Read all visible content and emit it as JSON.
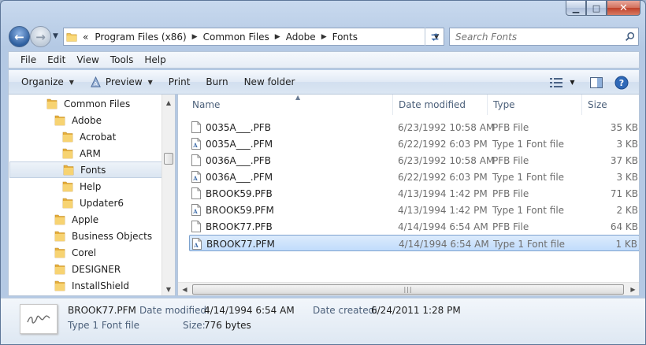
{
  "window": {
    "caption": {
      "minimize": "▁",
      "maximize": "□",
      "close": "✕"
    }
  },
  "address": {
    "overflow": "«",
    "crumbs": [
      "Program Files (x86)",
      "Common Files",
      "Adobe",
      "Fonts"
    ]
  },
  "search": {
    "placeholder": "Search Fonts"
  },
  "menu": [
    "File",
    "Edit",
    "View",
    "Tools",
    "Help"
  ],
  "toolbar": {
    "organize": "Organize",
    "preview": "Preview",
    "print": "Print",
    "burn": "Burn",
    "new_folder": "New folder"
  },
  "tree": [
    {
      "label": "Common Files",
      "level": 0
    },
    {
      "label": "Adobe",
      "level": 1
    },
    {
      "label": "Acrobat",
      "level": 2
    },
    {
      "label": "ARM",
      "level": 2
    },
    {
      "label": "Fonts",
      "level": 2,
      "selected": true
    },
    {
      "label": "Help",
      "level": 2
    },
    {
      "label": "Updater6",
      "level": 2
    },
    {
      "label": "Apple",
      "level": 1
    },
    {
      "label": "Business Objects",
      "level": 1
    },
    {
      "label": "Corel",
      "level": 1
    },
    {
      "label": "DESIGNER",
      "level": 1
    },
    {
      "label": "InstallShield",
      "level": 1
    }
  ],
  "columns": {
    "name": "Name",
    "date": "Date modified",
    "type": "Type",
    "size": "Size"
  },
  "files": [
    {
      "name": "0035A___.PFB",
      "date": "6/23/1992 10:58 AM",
      "type": "PFB File",
      "size": "35 KB",
      "icon": "blank-file-icon"
    },
    {
      "name": "0035A___.PFM",
      "date": "6/22/1992 6:03 PM",
      "type": "Type 1 Font file",
      "size": "3 KB",
      "icon": "font-file-icon"
    },
    {
      "name": "0036A___.PFB",
      "date": "6/23/1992 10:58 AM",
      "type": "PFB File",
      "size": "37 KB",
      "icon": "blank-file-icon"
    },
    {
      "name": "0036A___.PFM",
      "date": "6/22/1992 6:03 PM",
      "type": "Type 1 Font file",
      "size": "3 KB",
      "icon": "font-file-icon"
    },
    {
      "name": "BROOK59.PFB",
      "date": "4/13/1994 1:42 PM",
      "type": "PFB File",
      "size": "71 KB",
      "icon": "blank-file-icon"
    },
    {
      "name": "BROOK59.PFM",
      "date": "4/13/1994 1:42 PM",
      "type": "Type 1 Font file",
      "size": "2 KB",
      "icon": "font-file-icon"
    },
    {
      "name": "BROOK77.PFB",
      "date": "4/14/1994 6:54 AM",
      "type": "PFB File",
      "size": "64 KB",
      "icon": "blank-file-icon"
    },
    {
      "name": "BROOK77.PFM",
      "date": "4/14/1994 6:54 AM",
      "type": "Type 1 Font file",
      "size": "1 KB",
      "icon": "font-file-icon",
      "selected": true
    }
  ],
  "details": {
    "filename": "BROOK77.PFM",
    "filetype": "Type 1 Font file",
    "date_modified_label": "Date modified:",
    "date_modified": "4/14/1994 6:54 AM",
    "date_created_label": "Date created:",
    "date_created": "6/24/2011 1:28 PM",
    "size_label": "Size:",
    "size": "776 bytes"
  },
  "colors": {
    "selection": "#c1dcfc",
    "selection_border": "#7da2ce",
    "folder": "#f2c55c"
  }
}
